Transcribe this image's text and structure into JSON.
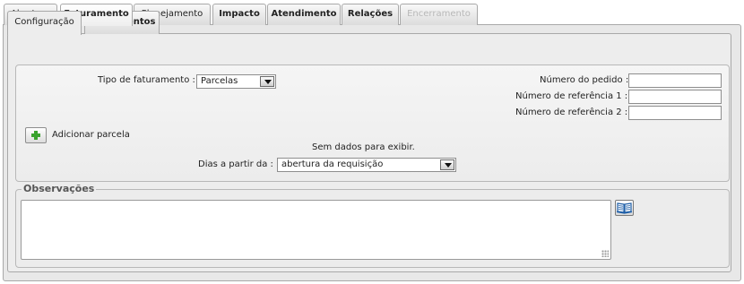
{
  "tabs": [
    {
      "label": "Abertura",
      "state": "normal"
    },
    {
      "label": "Faturamento",
      "state": "active"
    },
    {
      "label": "Planejamento",
      "state": "normal"
    },
    {
      "label": "Impacto",
      "state": "normal"
    },
    {
      "label": "Atendimento",
      "state": "normal"
    },
    {
      "label": "Relações",
      "state": "normal"
    },
    {
      "label": "Encerramento",
      "state": "disabled"
    }
  ],
  "subtabs": [
    {
      "label": "Configuração",
      "state": "active"
    },
    {
      "label": "Lançamentos",
      "state": "normal"
    }
  ],
  "config": {
    "tipo_label": "Tipo de faturamento :",
    "tipo_value": "Parcelas",
    "numero_pedido_label": "Número do pedido :",
    "numero_pedido_value": "",
    "ref1_label": "Número de referência 1 :",
    "ref1_value": "",
    "ref2_label": "Número de referência 2 :",
    "ref2_value": "",
    "add_parcela_label": "Adicionar parcela",
    "empty_message": "Sem dados para exibir.",
    "dias_label": "Dias a partir da :",
    "dias_value": "abertura da requisição"
  },
  "observacoes": {
    "legend": "Observações",
    "value": ""
  },
  "icons": {
    "add": "plus-icon",
    "book": "book-icon",
    "dropdown": "chevron-down-icon"
  },
  "colors": {
    "plus_green": "#3aa32e",
    "book_blue": "#1f5fa8",
    "disabled_text": "#b8b8b8"
  }
}
